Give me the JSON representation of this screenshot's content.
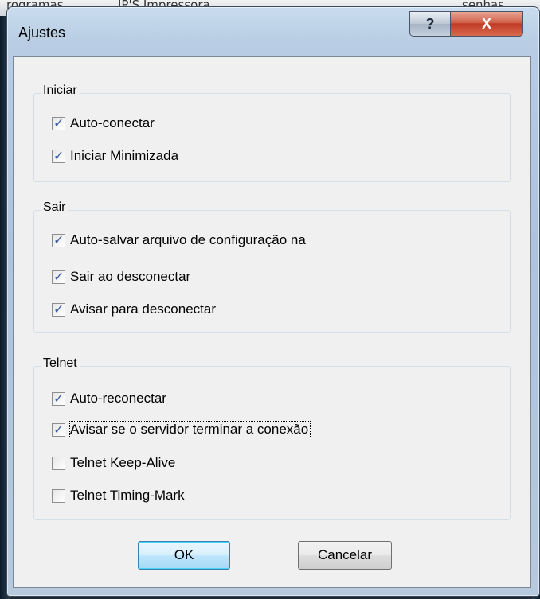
{
  "background": {
    "text_left": "rogramas",
    "text_mid": "IP'S Impressora",
    "text_right": "senhas"
  },
  "window": {
    "title": "Ajustes",
    "help_label": "?",
    "close_label": "X"
  },
  "groups": {
    "iniciar": {
      "label": "Iniciar",
      "items": [
        {
          "label": "Auto-conectar",
          "checked": true
        },
        {
          "label": "Iniciar Minimizada",
          "checked": true
        }
      ]
    },
    "sair": {
      "label": "Sair",
      "items": [
        {
          "label": "Auto-salvar arquivo de configuração na",
          "checked": true
        },
        {
          "label": "Sair ao desconectar",
          "checked": true
        },
        {
          "label": "Avisar para desconectar",
          "checked": true
        }
      ]
    },
    "telnet": {
      "label": "Telnet",
      "items": [
        {
          "label": "Auto-reconectar",
          "checked": true
        },
        {
          "label": "Avisar se o servidor terminar a conexão",
          "checked": true
        },
        {
          "label": "Telnet Keep-Alive",
          "checked": false
        },
        {
          "label": "Telnet Timing-Mark",
          "checked": false
        }
      ]
    }
  },
  "buttons": {
    "ok": "OK",
    "cancel": "Cancelar"
  }
}
